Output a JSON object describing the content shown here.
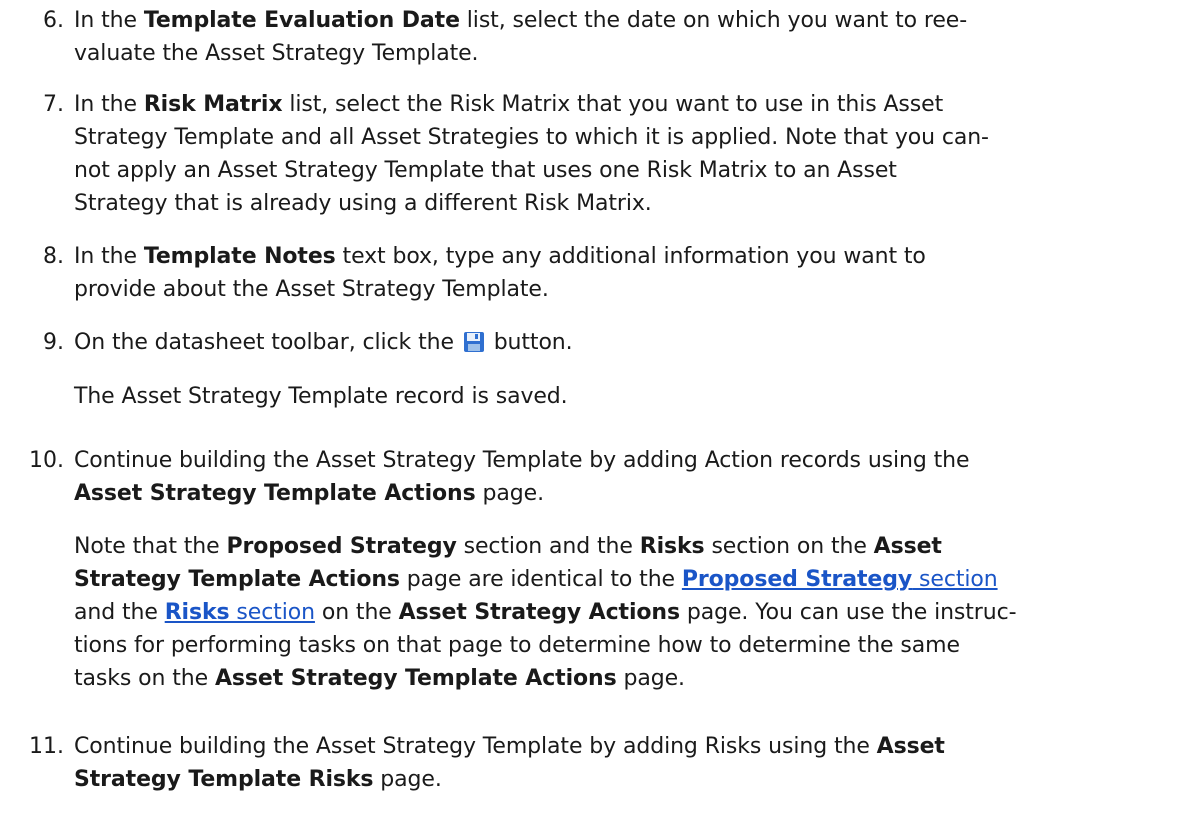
{
  "steps": [
    {
      "number": "6.",
      "pre": "In the ",
      "bold": "Template Evaluation Date",
      "line1_rest": " list, select the date on which you want to ree-",
      "line2": "valuate the Asset Strategy Template."
    },
    {
      "number": "7.",
      "pre": "In the ",
      "bold": "Risk Matrix",
      "line1_rest": " list, select the Risk Matrix that you want to use in this Asset",
      "line2": "Strategy Template and all Asset Strategies to which it is applied. Note that you can-",
      "line3": "not apply an Asset Strategy Template that uses one Risk Matrix to an Asset",
      "line4": "Strategy that is already using a different Risk Matrix."
    },
    {
      "number": "8.",
      "pre": "In the ",
      "bold": "Template Notes",
      "line1_rest": " text box, type any additional information you want to",
      "line2": "provide about the Asset Strategy Template."
    },
    {
      "number": "9.",
      "pre": "On the datasheet toolbar, click the ",
      "post": " button.",
      "result": "The Asset Strategy Template record is saved."
    },
    {
      "number": "10.",
      "line1": "Continue building the Asset Strategy Template by adding Action records using the",
      "line2_bold": "Asset Strategy Template Actions",
      "line2_rest": " page.",
      "note": {
        "a": "Note that the ",
        "b": "Proposed Strategy",
        "c": " section and the ",
        "d": "Risks",
        "e": " section on the ",
        "f": "Asset",
        "g": "Strategy Template Actions",
        "h": " page are identical to the ",
        "link1_bold": "Proposed Strategy",
        "link1_rest": " section",
        "i": "and the ",
        "link2_bold": "Risks",
        "link2_rest": " section",
        "j": " on the ",
        "k": "Asset Strategy Actions",
        "l": " page. You can use the instruc-",
        "m": "tions for performing tasks on that page to determine how to determine the same",
        "n": "tasks on the ",
        "o": "Asset Strategy Template Actions",
        "p": " page."
      }
    },
    {
      "number": "11.",
      "line1": "Continue building the Asset Strategy Template by adding Risks using the ",
      "line1_bold": "Asset",
      "line2_bold": "Strategy Template Risks",
      "line2_rest": " page."
    }
  ],
  "icons": {
    "save": "floppy-disk-save-icon"
  },
  "colors": {
    "link": "#1a55c7",
    "icon_blue": "#2f6fd0"
  }
}
